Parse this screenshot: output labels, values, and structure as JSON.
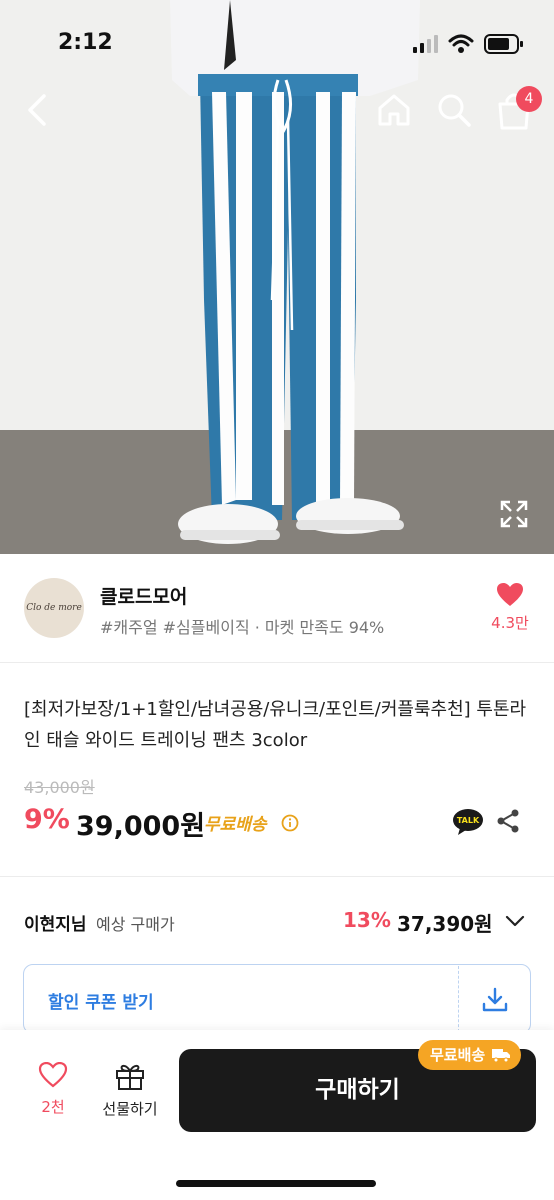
{
  "status_bar": {
    "time": "2:12"
  },
  "nav": {
    "back_icon": "chevron-left-icon",
    "home_icon": "home-icon",
    "search_icon": "search-icon",
    "cart_icon": "shopping-bag-icon",
    "cart_count": "4"
  },
  "shop": {
    "logo_text": "Clo de more",
    "name": "클로드모어",
    "tags": "#캐주얼 #심플베이직 · 마켓 만족도 94%",
    "like_count": "4.3만"
  },
  "product": {
    "title": "[최저가보장/1+1할인/남녀공용/유니크/포인트/커플룩추천] 투톤라인 태슬 와이드 트레이닝 팬츠 3color",
    "original_price": "43,000원",
    "discount_rate": "9%",
    "sale_price": "39,000원",
    "free_shipping": "무료배송"
  },
  "member_price": {
    "name": "이현지님",
    "label": "예상 구매가",
    "rate": "13%",
    "price": "37,390원"
  },
  "coupon": {
    "label": "할인 쿠폰 받기"
  },
  "bottom": {
    "wish_count": "2천",
    "gift_label": "선물하기",
    "buy_label": "구매하기",
    "ship_badge": "무료배송"
  },
  "colors": {
    "accent_red": "#f04b5e",
    "free_ship_orange": "#e8a21a",
    "coupon_blue": "#2e7de1",
    "buy_button": "#1a1a1a"
  }
}
